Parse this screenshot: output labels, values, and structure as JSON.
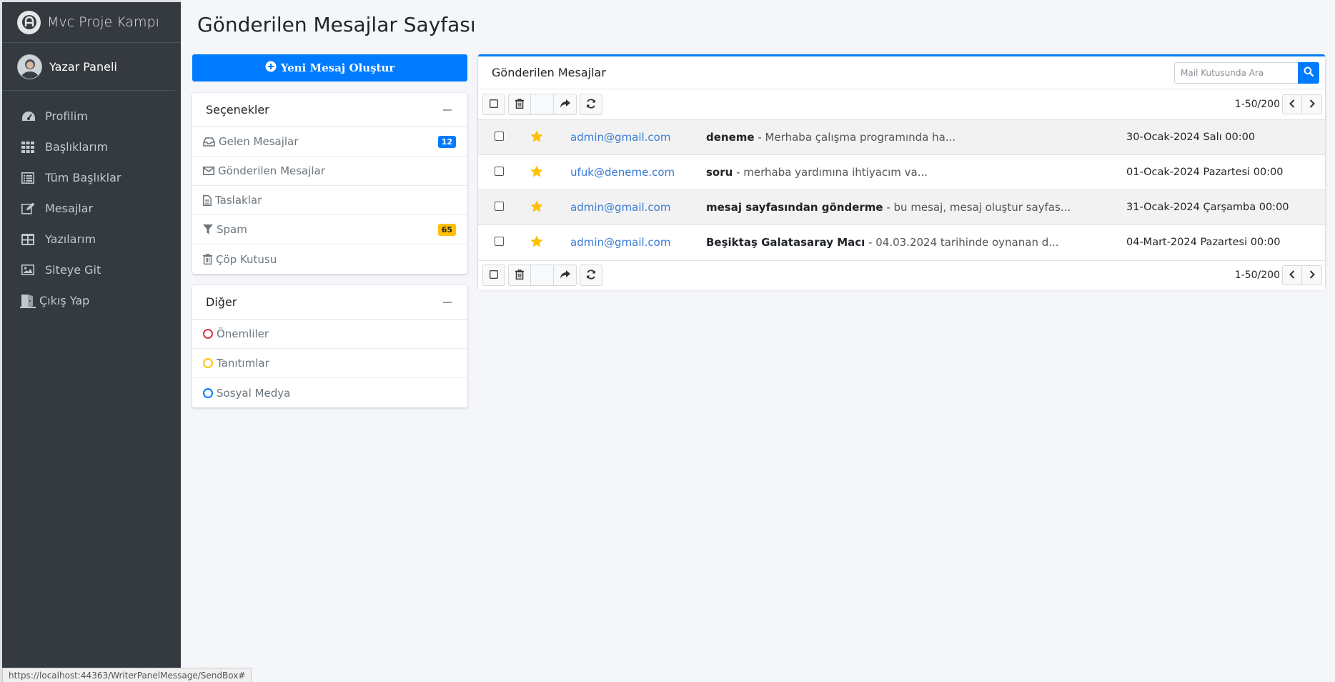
{
  "brand": {
    "title": "Mvc Proje Kampı",
    "logo_letter": "A"
  },
  "user": {
    "name": "Yazar Paneli"
  },
  "sidebar": {
    "items": [
      {
        "label": "Profilim",
        "icon": "dashboard-icon"
      },
      {
        "label": "Başlıklarım",
        "icon": "grid-icon"
      },
      {
        "label": "Tüm Başlıklar",
        "icon": "list-icon"
      },
      {
        "label": "Mesajlar",
        "icon": "edit-icon"
      },
      {
        "label": "Yazılarım",
        "icon": "table-icon"
      },
      {
        "label": "Siteye Git",
        "icon": "image-icon"
      },
      {
        "label": "Çıkış Yap",
        "icon": "exit-icon"
      }
    ]
  },
  "page": {
    "title": "Gönderilen Mesajlar Sayfası"
  },
  "compose": {
    "label": "Yeni Mesaj Oluştur"
  },
  "folders": {
    "title": "Seçenekler",
    "items": [
      {
        "label": "Gelen Mesajlar",
        "badge": "12",
        "badge_color": "#007bff"
      },
      {
        "label": "Gönderilen Mesajlar"
      },
      {
        "label": "Taslaklar"
      },
      {
        "label": "Spam",
        "badge": "65",
        "badge_color": "#ffc107"
      },
      {
        "label": "Çöp Kutusu"
      }
    ]
  },
  "labels": {
    "title": "Diğer",
    "items": [
      {
        "label": "Önemliler",
        "color": "#dc3545"
      },
      {
        "label": "Tanıtımlar",
        "color": "#ffc107"
      },
      {
        "label": "Sosyal Medya",
        "color": "#007bff"
      }
    ]
  },
  "mailbox": {
    "title": "Gönderilen Mesajlar",
    "search_placeholder": "Mail Kutusunda Ara",
    "pager": "1-50/200",
    "messages": [
      {
        "to": "admin@gmail.com",
        "subject": "deneme",
        "preview": " - Merhaba çalışma programında ha...",
        "date": "30-Ocak-2024 Salı 00:00"
      },
      {
        "to": "ufuk@deneme.com",
        "subject": "soru",
        "preview": " - merhaba yardımına ihtiyacım va...",
        "date": "01-Ocak-2024 Pazartesi 00:00"
      },
      {
        "to": "admin@gmail.com",
        "subject": "mesaj sayfasından gönderme",
        "preview": " - bu mesaj, mesaj oluştur sayfas...",
        "date": "31-Ocak-2024 Çarşamba 00:00"
      },
      {
        "to": "admin@gmail.com",
        "subject": "Beşiktaş Galatasaray Macı",
        "preview": " - 04.03.2024 tarihinde oynanan d...",
        "date": "04-Mart-2024 Pazartesi 00:00"
      }
    ]
  },
  "status_url": "https://localhost:44363/WriterPanelMessage/SendBox#",
  "colors": {
    "primary": "#007bff",
    "sidebar_bg": "#343a40",
    "star": "#ffc107",
    "link": "#3a7bd5"
  }
}
